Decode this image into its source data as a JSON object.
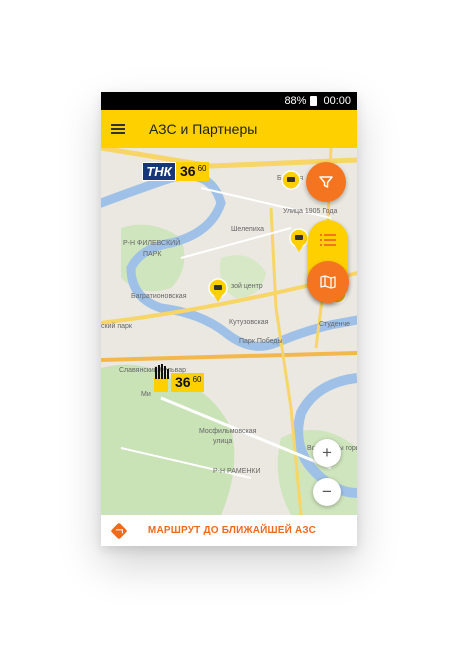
{
  "status": {
    "battery": "88%",
    "time": "00:00"
  },
  "header": {
    "title": "АЗС и Партнеры"
  },
  "map": {
    "labels": {
      "filevsky": "Р-Н ФИЛЕВСКИЙ",
      "park": "ПАРК",
      "shelepikha": "Шелепиха",
      "begovaya": "Беговая",
      "ulitsa1905": "Улица 1905 Года",
      "bagrationovskaya": "Багратионовская",
      "kutuzovskaya": "Кутузовская",
      "park_pobedy": "Парк Победы",
      "studencheskaya": "Студенче",
      "slavyansky": "Славянский бульвар",
      "mosfilm1": "Мосфильмовская",
      "mosfilm2": "улица",
      "ramenki": "Р-Н РАМЕНКИ",
      "vorobyovy": "Воробьевы горы",
      "ovoy_center": "зой центр",
      "kiy_park": "ский парк",
      "mi": "Ми"
    },
    "stations": [
      {
        "brand": "ТНК",
        "price_main": "36",
        "price_sup": "60"
      },
      {
        "brand": "Роснефть",
        "price_main": "36",
        "price_sup": "60"
      }
    ]
  },
  "controls": {
    "zoom_in": "+",
    "zoom_out": "−"
  },
  "footer": {
    "route_label": "МАРШРУТ ДО БЛИЖАЙШЕЙ АЗС"
  },
  "colors": {
    "accent": "#ffd000",
    "orange": "#f4741f",
    "water": "#9fc1e8",
    "park": "#c5e0b3"
  }
}
